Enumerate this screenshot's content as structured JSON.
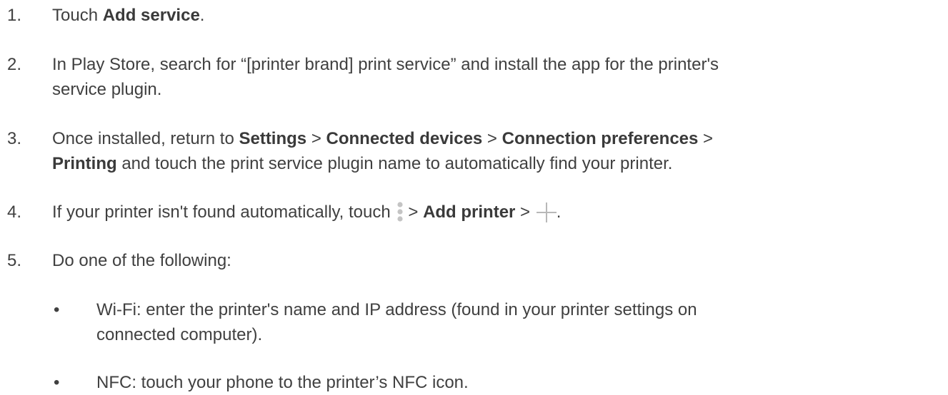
{
  "steps": [
    {
      "num": "1.",
      "pre": "Touch ",
      "b1": "Add service",
      "post": "."
    },
    {
      "num": "2.",
      "line1": "In Play Store, search for “[printer brand] print service” and install the app for the printer's",
      "line2": "service plugin."
    },
    {
      "num": "3.",
      "pre": "Once installed, return to ",
      "b1": "Settings",
      "sep1": " > ",
      "b2": "Connected devices",
      "sep2": " > ",
      "b3": "Connection preferences",
      "sep3": " >",
      "b4": "Printing",
      "post": " and touch the print service plugin name to automatically find your printer."
    },
    {
      "num": "4.",
      "pre": "If your printer isn't found automatically, touch ",
      "icon1": "more-vert-icon",
      "sep1": "> ",
      "b1": "Add printer",
      "sep2": " > ",
      "icon2": "plus-icon",
      "post": "."
    },
    {
      "num": "5.",
      "text": "Do one of the following:"
    }
  ],
  "bullets": [
    {
      "mark": "•",
      "line1": "Wi-Fi: enter the printer's name and IP address (found in your printer settings on",
      "line2": "connected computer)."
    },
    {
      "mark": "•",
      "line1": "NFC: touch your phone to the printer’s NFC icon."
    }
  ],
  "colors": {
    "text": "#404040",
    "icon": "#bdbdbd"
  }
}
